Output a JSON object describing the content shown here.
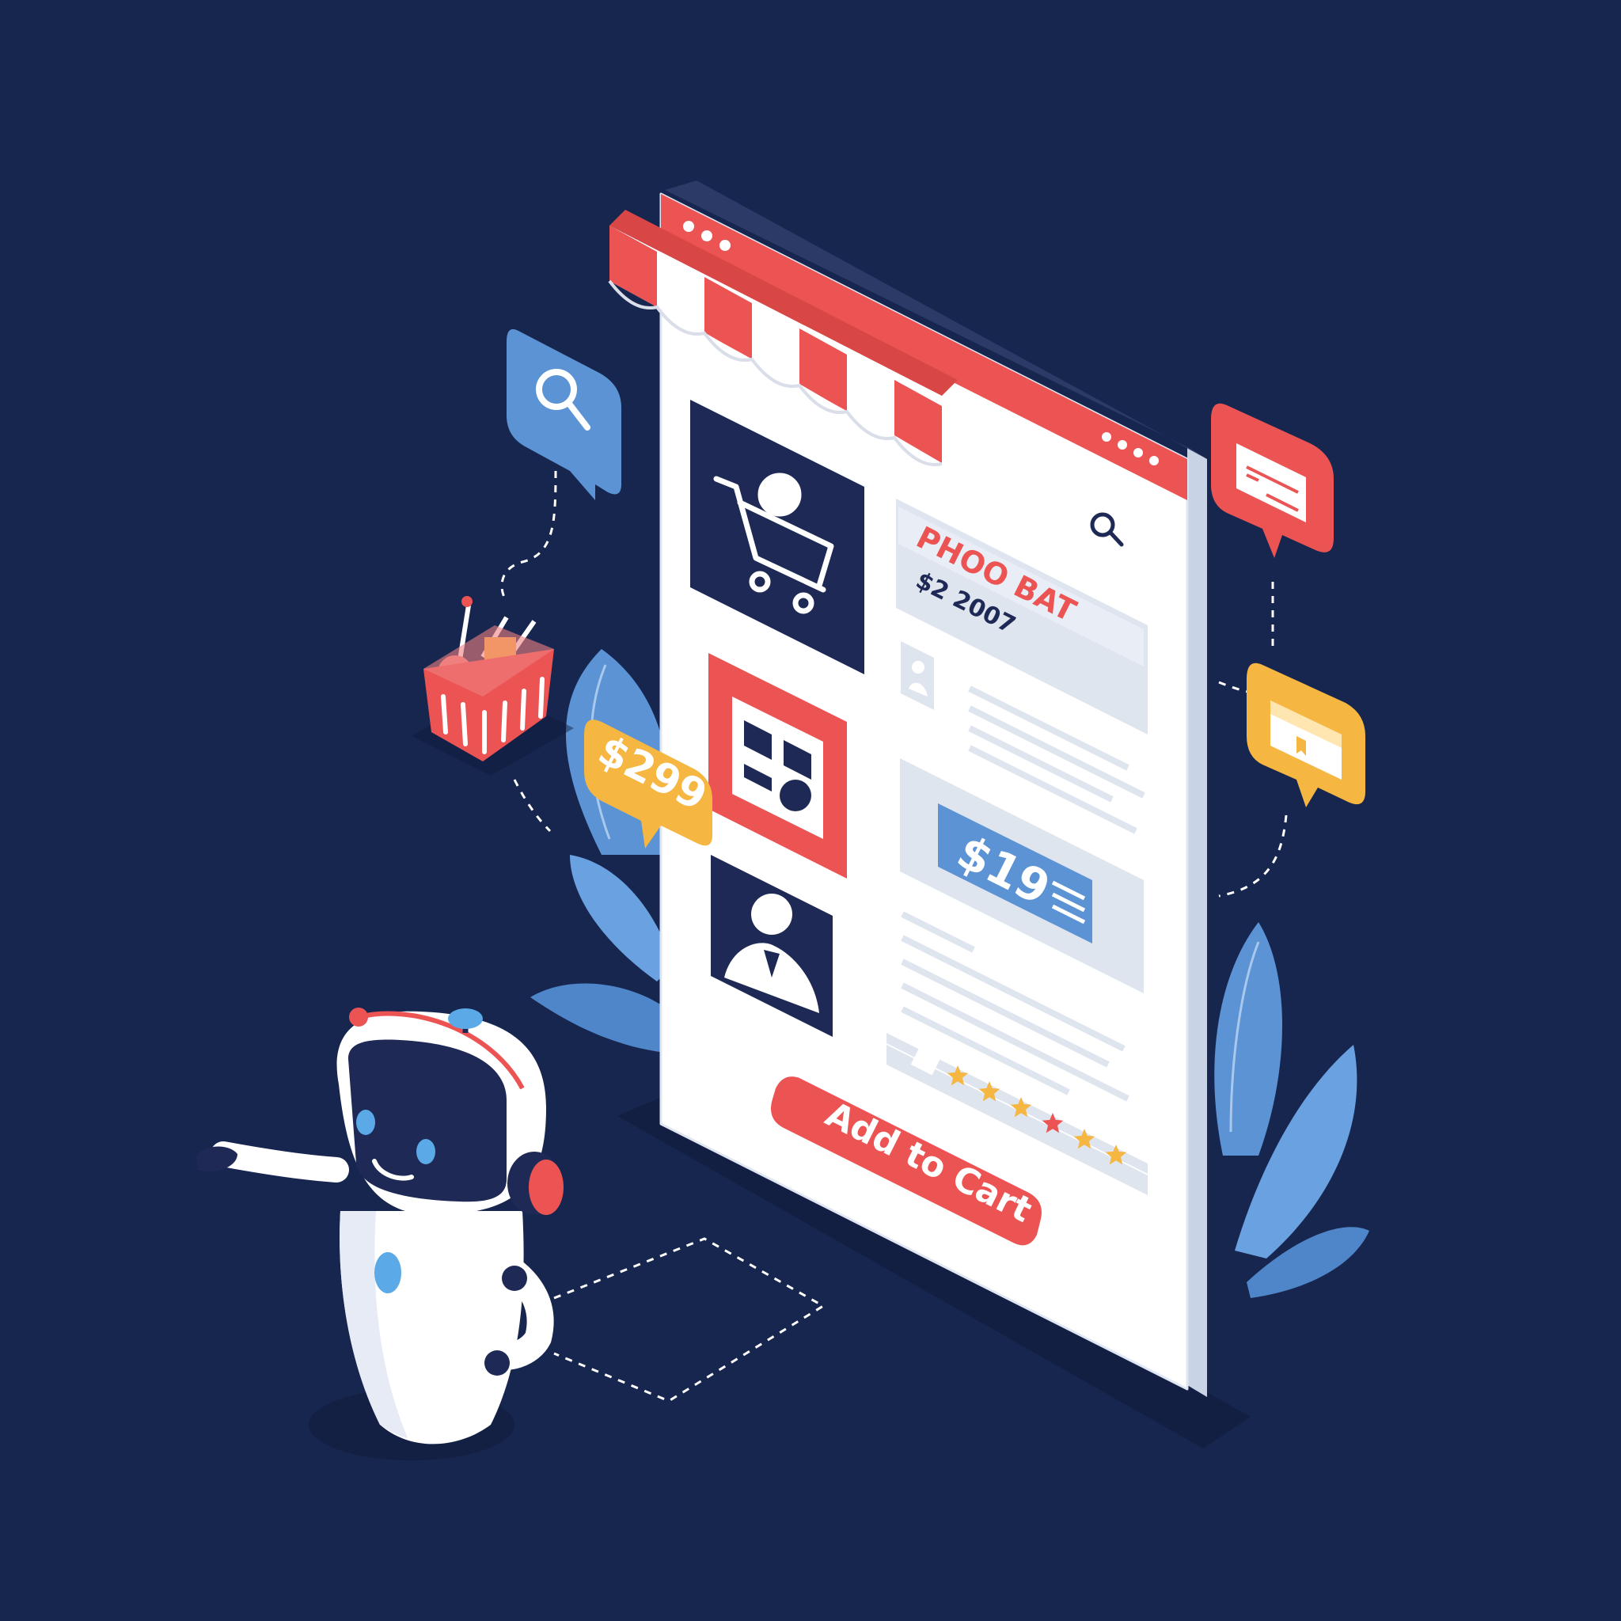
{
  "product": {
    "name": "PHOO BAT",
    "price": "$2 2007"
  },
  "badges": {
    "price_large": "$299",
    "price_small": "$19"
  },
  "cta": {
    "label": "Add to Cart"
  },
  "rating": {
    "stars": 6
  },
  "colors": {
    "background": "#17264f",
    "accent_red": "#ec5454",
    "accent_blue": "#5b93d4",
    "accent_yellow": "#f5b642",
    "navy": "#1e2a55",
    "panel": "#ffffff"
  },
  "icons": [
    "search-icon",
    "shopping-cart-icon",
    "basket-icon",
    "card-icon",
    "wallet-icon",
    "user-icon",
    "document-icon",
    "robot-icon",
    "star-icon"
  ]
}
